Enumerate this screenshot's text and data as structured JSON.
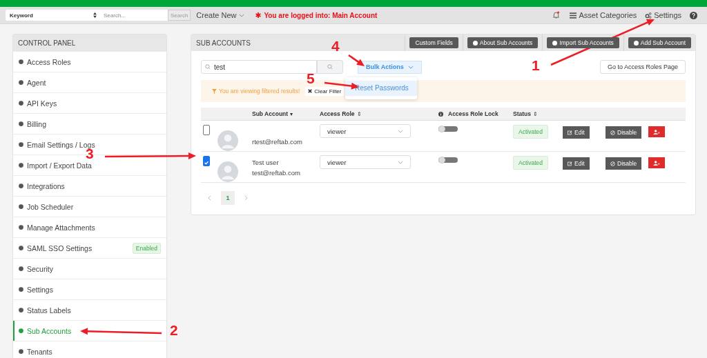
{
  "top_bar": {
    "keyword_select": "Keyword",
    "search": {
      "placeholder": "Search..."
    },
    "search_button": "Search",
    "create_new": "Create New",
    "login_notice": "You are logged into: Main Account",
    "notifications_unread": true,
    "links": [
      "Asset Categories",
      "Settings"
    ]
  },
  "sidebar": {
    "title": "CONTROL PANEL",
    "items": [
      {
        "label": "Access Roles",
        "selected": false
      },
      {
        "label": "Agent",
        "selected": false
      },
      {
        "label": "API Keys",
        "selected": false
      },
      {
        "label": "Billing",
        "selected": false
      },
      {
        "label": "Email Settings / Logs",
        "selected": false
      },
      {
        "label": "Import / Export Data",
        "selected": false
      },
      {
        "label": "Integrations",
        "selected": false
      },
      {
        "label": "Job Scheduler",
        "selected": false
      },
      {
        "label": "Manage Attachments",
        "selected": false
      },
      {
        "label": "SAML SSO Settings",
        "selected": false,
        "badge": "Enabled"
      },
      {
        "label": "Security",
        "selected": false
      },
      {
        "label": "Settings",
        "selected": false
      },
      {
        "label": "Status Labels",
        "selected": false
      },
      {
        "label": "Sub Accounts",
        "selected": true
      },
      {
        "label": "Tenants",
        "selected": false
      }
    ]
  },
  "panel": {
    "title": "SUB ACCOUNTS",
    "header_buttons": [
      "Custom Fields",
      "About Sub Accounts",
      "Import Sub Accounts",
      "Add Sub Account"
    ],
    "search": {
      "value": "test"
    },
    "bulk_actions": {
      "label": "Bulk Actions",
      "expanded": true,
      "menu": [
        {
          "label": "Reset Passwords",
          "selected": true
        }
      ]
    },
    "access_roles_button": "Go to Access Roles Page",
    "filter_notice": "You are viewing filtered results!",
    "clear_filter": "Clear Filter",
    "table": {
      "columns": [
        {
          "label": "Sub Account",
          "sort": "▾"
        },
        {
          "label": "Access Role",
          "sort": "⇕"
        },
        {
          "label": "Access Role Lock",
          "info": true
        },
        {
          "label": "Status",
          "sort": "⇕"
        }
      ],
      "rows": [
        {
          "checked": false,
          "email": "rtest@reftab.com",
          "role": "viewer",
          "lock_on": false,
          "status": "Activated",
          "edit": "Edit",
          "disable": "Disable"
        },
        {
          "checked": true,
          "name": "Test user",
          "email": "test@reftab.com",
          "role": "viewer",
          "lock_on": false,
          "status": "Activated",
          "edit": "Edit",
          "disable": "Disable"
        }
      ]
    },
    "pagination": [
      {
        "label": "1",
        "selected": true
      }
    ]
  },
  "annotations": [
    {
      "label": "1"
    },
    {
      "label": "2"
    },
    {
      "label": "3"
    },
    {
      "label": "4"
    },
    {
      "label": "5"
    }
  ]
}
